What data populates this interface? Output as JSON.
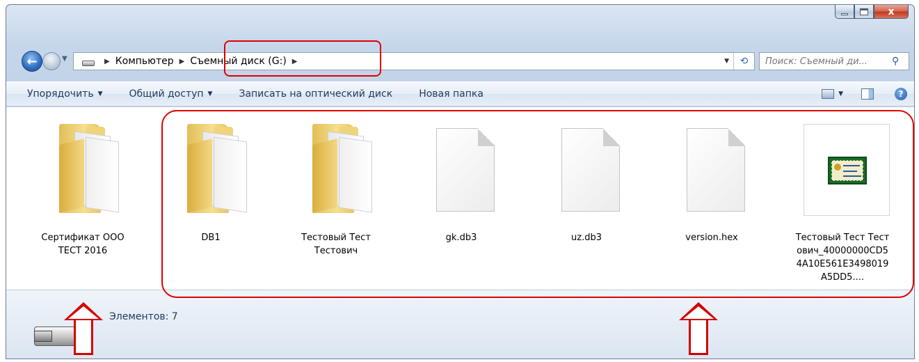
{
  "window": {
    "close_label": "x"
  },
  "nav": {
    "back_glyph": "←",
    "hist_glyph": "▼",
    "crumbs": [
      "Компьютер",
      "Съемный диск (G:)"
    ],
    "arrow_glyph": "▶",
    "refresh_glyph": "⟲",
    "search_placeholder": "Поиск: Съемный ди...",
    "search_icon_glyph": "⚲"
  },
  "toolbar": {
    "organize": "Упорядочить",
    "share": "Общий доступ",
    "burn": "Записать на оптический диск",
    "new_folder": "Новая папка",
    "caret": "▼",
    "help_glyph": "?"
  },
  "files": [
    {
      "name": "Сертификат ООО ТЕСТ 2016",
      "type": "folder"
    },
    {
      "name": "DB1",
      "type": "folder"
    },
    {
      "name": "Тестовый Тест Тестович",
      "type": "folder"
    },
    {
      "name": "gk.db3",
      "type": "file"
    },
    {
      "name": "uz.db3",
      "type": "file"
    },
    {
      "name": "version.hex",
      "type": "file"
    },
    {
      "name": "Тестовый Тест Тестович_40000000CD54A10E561E3498019A5DD5....",
      "type": "certificate"
    }
  ],
  "status": {
    "items_text": "Элементов: 7"
  },
  "colors": {
    "highlight": "#e00000",
    "window_frame": "#c5d6ea"
  }
}
